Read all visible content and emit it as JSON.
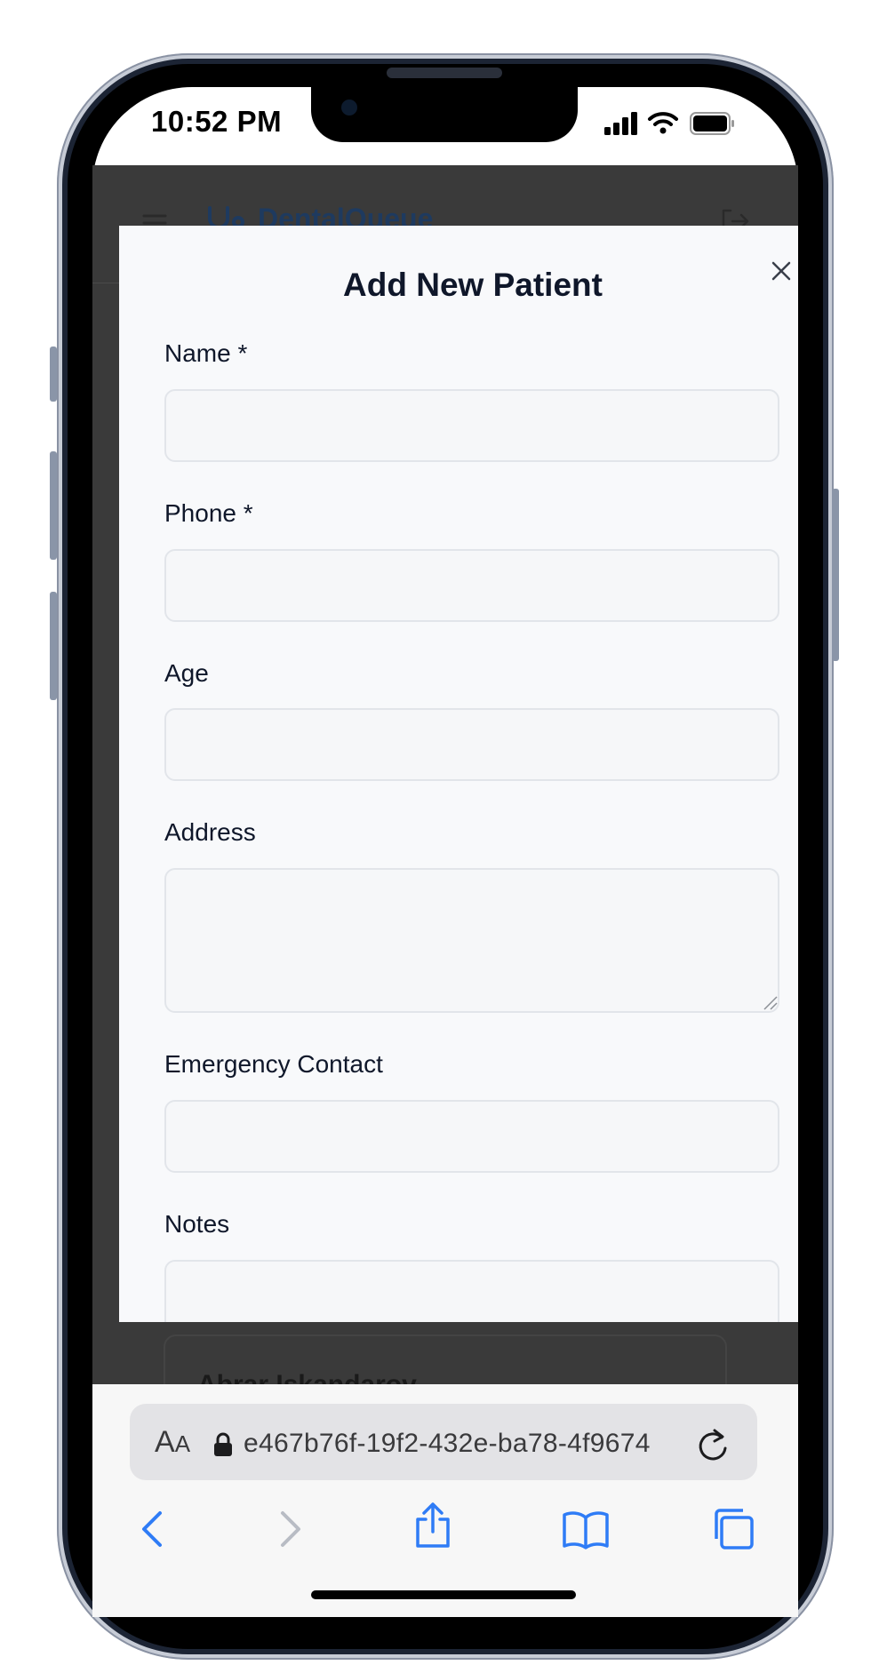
{
  "status_bar": {
    "time": "10:52 PM"
  },
  "app": {
    "brand": "DentalQueue",
    "background_card_name": "Abrar Iskandarov"
  },
  "modal": {
    "title": "Add New Patient",
    "fields": [
      {
        "label": "Name *",
        "value": ""
      },
      {
        "label": "Phone *",
        "value": ""
      },
      {
        "label": "Age",
        "value": ""
      },
      {
        "label": "Address",
        "value": ""
      },
      {
        "label": "Emergency Contact",
        "value": ""
      },
      {
        "label": "Notes",
        "value": ""
      }
    ]
  },
  "browser": {
    "aa_large": "A",
    "aa_small": "A",
    "url": "e467b76f-19f2-432e-ba78-4f9674"
  },
  "icons": {
    "menu": "menu-icon",
    "tooth": "tooth-icon",
    "logout": "logout-icon",
    "close": "close-icon",
    "lock": "lock-icon",
    "reload": "reload-icon",
    "back": "chevron-left-icon",
    "forward": "chevron-right-icon",
    "share": "share-icon",
    "bookmarks": "book-icon",
    "tabs": "tabs-icon"
  },
  "colors": {
    "accent": "#2f7cf6",
    "modal_bg": "#f8f9fb",
    "overlay": "#3a3a3a"
  }
}
